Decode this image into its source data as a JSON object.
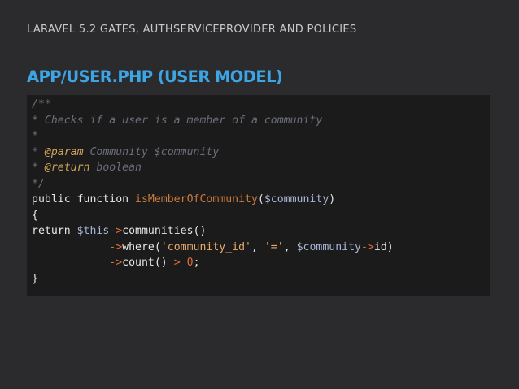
{
  "slide": {
    "header": "LARAVEL 5.2 GATES, AUTHSERVICEPROVIDER AND POLICIES",
    "title": "APP/USER.PHP (USER MODEL)"
  },
  "code": {
    "l1": "/**",
    "l2": "* Checks if a user is a member of a community",
    "l3": "*",
    "l4_star": "* ",
    "l4_tag": "@param",
    "l4_rest": " Community $community",
    "l5_star": "* ",
    "l5_tag": "@return",
    "l5_rest": " boolean",
    "l6": "*/",
    "l7_kw": "public function ",
    "l7_fn": "isMemberOfCommunity",
    "l7_p1": "(",
    "l7_var": "$community",
    "l7_p2": ")",
    "l8": "{",
    "l9_kw": "return ",
    "l9_var": "$this",
    "l9_op": "->",
    "l9_call": "communities()",
    "l10_ind": "            ",
    "l10_op": "->",
    "l10_call": "where(",
    "l10_s1": "'community_id'",
    "l10_c1": ", ",
    "l10_s2": "'='",
    "l10_c2": ", ",
    "l10_var": "$community",
    "l10_op2": "->",
    "l10_end": "id)",
    "l11_ind": "            ",
    "l11_op": "->",
    "l11_call": "count() ",
    "l11_gt": ">",
    "l11_sp": " ",
    "l11_num": "0",
    "l11_end": ";",
    "l12": "}"
  },
  "colors": {
    "background": "#2b2b2d",
    "code_background": "#1b1b1c",
    "title": "#3da5e4",
    "comment": "#6b6f78",
    "doc_tag": "#d4a45a",
    "function_name": "#c97a3c",
    "variable": "#a8b6d6",
    "string": "#e8a96b",
    "operator": "#e06c3c"
  }
}
